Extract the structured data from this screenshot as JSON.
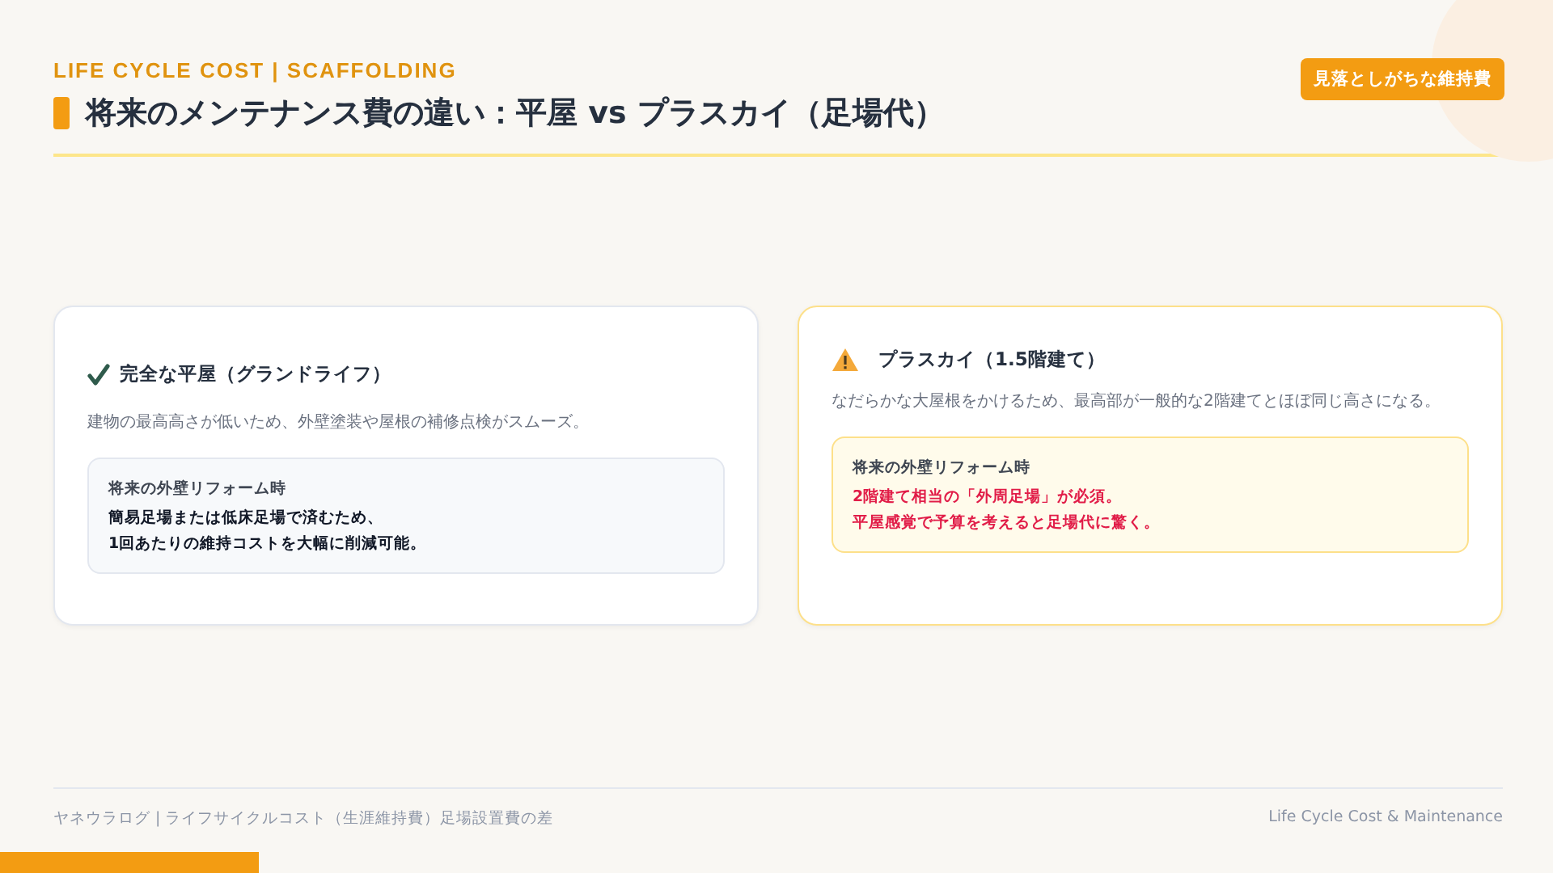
{
  "header": {
    "eyebrow": "LIFE CYCLE COST | SCAFFOLDING",
    "title": "将来のメンテナンス費の違い：平屋 vs プラスカイ（足場代）",
    "badge": "見落としがちな維持費"
  },
  "cards": [
    {
      "kind": "good",
      "title": "完全な平屋（グランドライフ）",
      "description": "建物の最高高さが低いため、外壁塗装や屋根の補修点検がスムーズ。",
      "note": {
        "label": "将来の外壁リフォーム時",
        "lines": [
          "簡易足場または低床足場で済むため、",
          "1回あたりの維持コストを大幅に削減可能。"
        ]
      }
    },
    {
      "kind": "warning",
      "title": "プラスカイ（1.5階建て）",
      "description": "なだらかな大屋根をかけるため、最高部が一般的な2階建てとほぼ同じ高さになる。",
      "note": {
        "label": "将来の外壁リフォーム時",
        "lines": [
          "2階建て相当の「外周足場」が必須。",
          "平屋感覚で予算を考えると足場代に驚く。"
        ]
      }
    }
  ],
  "footer": {
    "left": "ヤネウラログ | ライフサイクルコスト（生涯維持費）足場設置費の差",
    "right": "Life Cycle Cost & Maintenance"
  }
}
